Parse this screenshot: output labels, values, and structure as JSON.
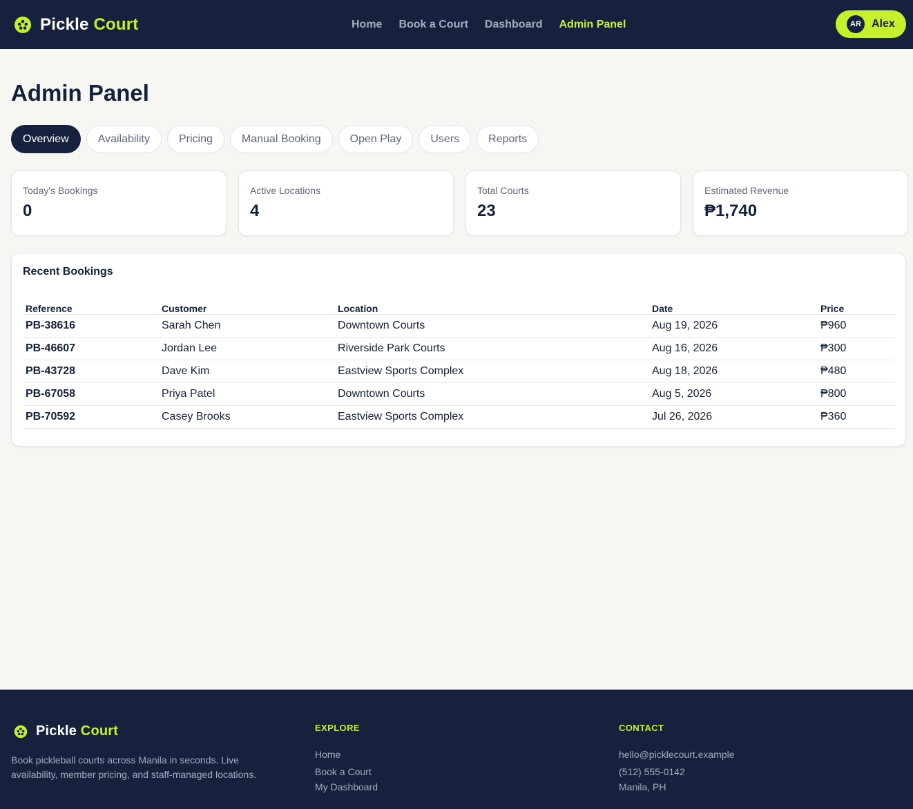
{
  "header": {
    "brand_part1": "Pickle",
    "brand_part2": "Court",
    "brand_icon": "pickleball-icon",
    "nav": [
      {
        "label": "Home",
        "active": false
      },
      {
        "label": "Book a Court",
        "active": false
      },
      {
        "label": "Dashboard",
        "active": false
      },
      {
        "label": "Admin Panel",
        "active": true
      }
    ],
    "user": {
      "initials": "AR",
      "name": "Alex"
    }
  },
  "main": {
    "title": "Admin Panel",
    "tabs": [
      {
        "label": "Overview",
        "active": true
      },
      {
        "label": "Availability",
        "active": false
      },
      {
        "label": "Pricing",
        "active": false
      },
      {
        "label": "Manual Booking",
        "active": false
      },
      {
        "label": "Open Play",
        "active": false
      },
      {
        "label": "Users",
        "active": false
      },
      {
        "label": "Reports",
        "active": false
      }
    ],
    "stats": [
      {
        "label": "Today's Bookings",
        "value": "0"
      },
      {
        "label": "Active Locations",
        "value": "4"
      },
      {
        "label": "Total Courts",
        "value": "23"
      },
      {
        "label": "Estimated Revenue",
        "value": "₱1,740"
      }
    ],
    "recent_bookings": {
      "title": "Recent Bookings",
      "columns": [
        "Reference",
        "Customer",
        "Location",
        "Date",
        "Price"
      ],
      "rows": [
        [
          "PB-38616",
          "Sarah Chen",
          "Downtown Courts",
          "Aug 19, 2026",
          "₱960"
        ],
        [
          "PB-46607",
          "Jordan Lee",
          "Riverside Park Courts",
          "Aug 16, 2026",
          "₱300"
        ],
        [
          "PB-43728",
          "Dave Kim",
          "Eastview Sports Complex",
          "Aug 18, 2026",
          "₱480"
        ],
        [
          "PB-67058",
          "Priya Patel",
          "Downtown Courts",
          "Aug 5, 2026",
          "₱800"
        ],
        [
          "PB-70592",
          "Casey Brooks",
          "Eastview Sports Complex",
          "Jul 26, 2026",
          "₱360"
        ]
      ]
    }
  },
  "footer": {
    "brand_part1": "Pickle",
    "brand_part2": "Court",
    "description": "Book pickleball courts across Manila in seconds. Live availability, member pricing, and staff-managed locations.",
    "explore": {
      "heading": "EXPLORE",
      "links": [
        "Home",
        "Book a Court",
        "My Dashboard"
      ]
    },
    "contact": {
      "heading": "CONTACT",
      "items": [
        "hello@picklecourt.example",
        "(512) 555-0142",
        "Manila, PH"
      ]
    }
  },
  "colors": {
    "navy": "#16223d",
    "lime": "#c6f02b",
    "page_bg": "#f6f6f2",
    "muted_text": "#a3acbd"
  }
}
